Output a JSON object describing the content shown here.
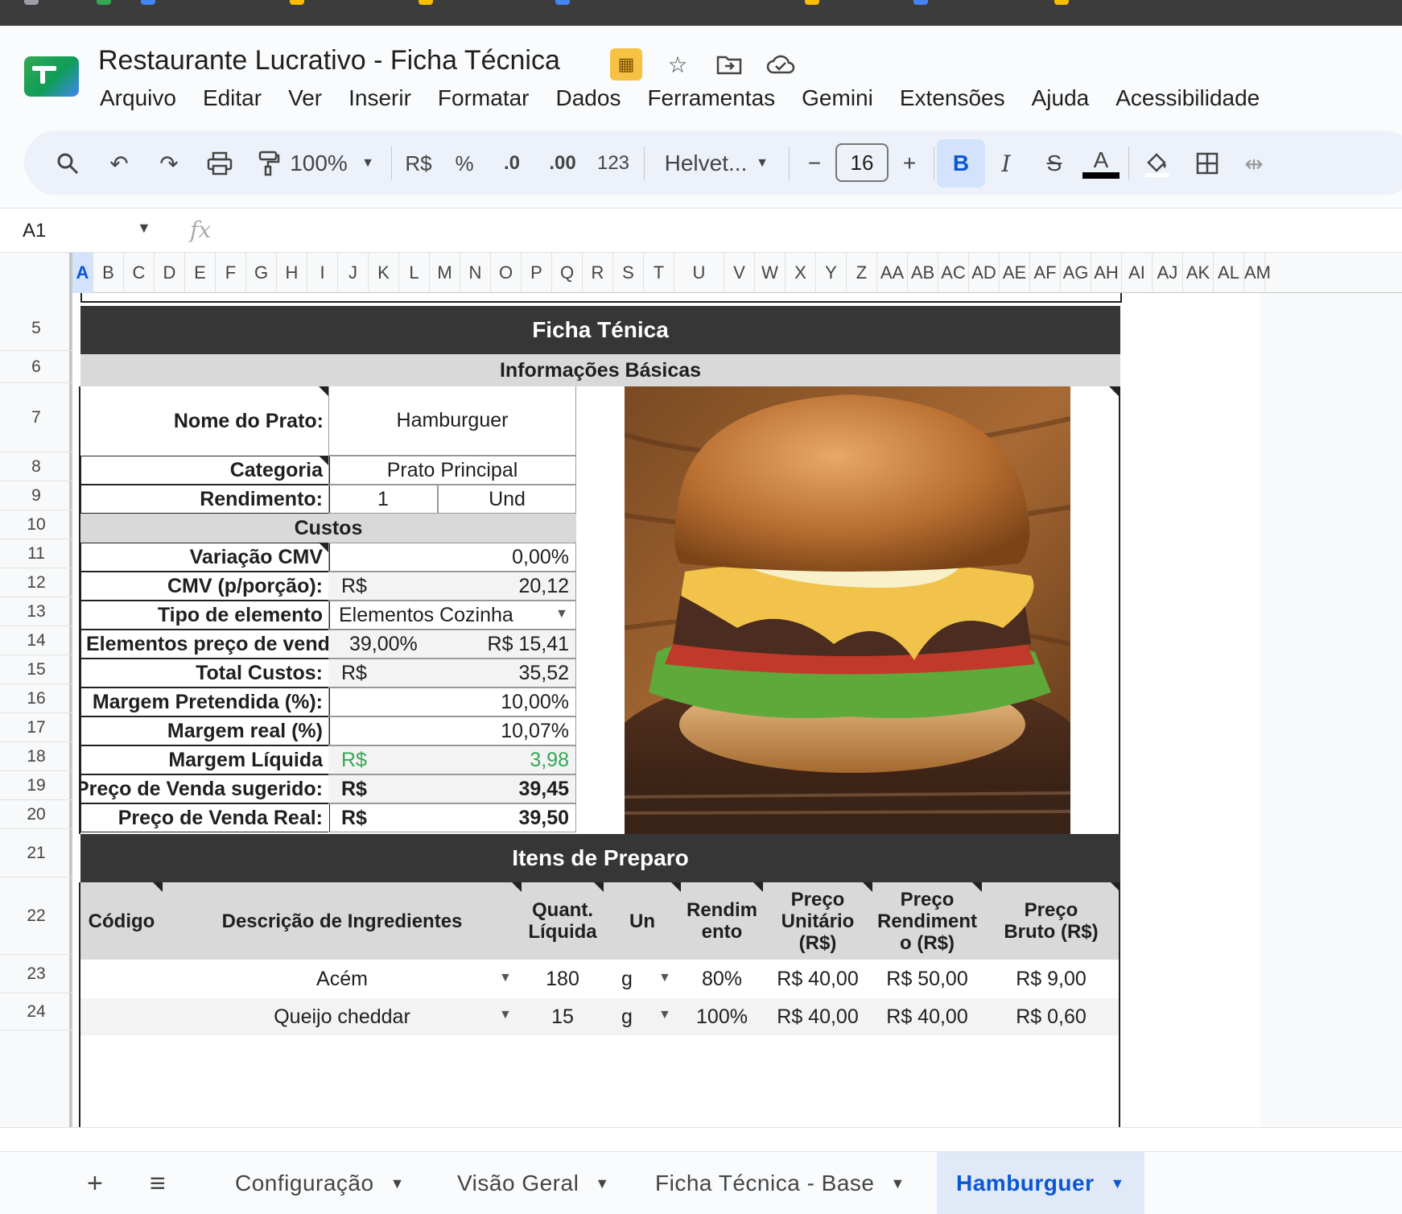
{
  "document": {
    "title": "Restaurante Lucrativo - Ficha Técnica"
  },
  "menu": [
    "Arquivo",
    "Editar",
    "Ver",
    "Inserir",
    "Formatar",
    "Dados",
    "Ferramentas",
    "Gemini",
    "Extensões",
    "Ajuda",
    "Acessibilidade"
  ],
  "toolbar": {
    "zoom": "100%",
    "currency": "R$",
    "percent": "%",
    "decrease_decimals": ".0",
    "increase_decimals": ".00",
    "number_format": "123",
    "font": "Helvet...",
    "font_size": "16",
    "minus": "−",
    "plus": "+",
    "bold": "B",
    "italic": "I",
    "strike": "S",
    "text_color": "A"
  },
  "formula_bar": {
    "cell_ref": "A1",
    "fx": "fx"
  },
  "columns": [
    "A",
    "B",
    "C",
    "D",
    "E",
    "F",
    "G",
    "H",
    "I",
    "J",
    "K",
    "L",
    "M",
    "N",
    "O",
    "P",
    "Q",
    "R",
    "S",
    "T",
    "U",
    "V",
    "W",
    "X",
    "Y",
    "Z",
    "AA",
    "AB",
    "AC",
    "AD",
    "AE",
    "AF",
    "AG",
    "AH",
    "AI",
    "AJ",
    "AK",
    "AL",
    "AM"
  ],
  "rows": [
    "5",
    "6",
    "7",
    "8",
    "9",
    "10",
    "11",
    "12",
    "13",
    "14",
    "15",
    "16",
    "17",
    "18",
    "19",
    "20",
    "21",
    "22",
    "23",
    "24"
  ],
  "sheet": {
    "header_title": "Ficha Ténica",
    "basic_info_title": "Informações Básicas",
    "dish_name_label": "Nome do Prato:",
    "dish_name": "Hamburguer",
    "category_label": "Categoria",
    "category": "Prato Principal",
    "yield_label": "Rendimento:",
    "yield_qty": "1",
    "yield_unit": "Und",
    "costs_title": "Custos",
    "cmv_variation_label": "Variação CMV",
    "cmv_variation": "0,00%",
    "cmv_portion_label": "CMV (p/porção):",
    "cmv_portion_currency": "R$",
    "cmv_portion": "20,12",
    "element_type_label": "Tipo de elemento",
    "element_type": "Elementos Cozinha",
    "sale_elements_label": "Elementos preço de venda (%",
    "sale_elements_pct": "39,00%",
    "sale_elements_value": "R$ 15,41",
    "total_costs_label": "Total Custos:",
    "total_costs_currency": "R$",
    "total_costs": "35,52",
    "target_margin_label": "Margem Pretendida (%):",
    "target_margin": "10,00%",
    "real_margin_label": "Margem real (%)",
    "real_margin": "10,07%",
    "net_margin_label": "Margem Líquida",
    "net_margin_currency": "R$",
    "net_margin": "3,98",
    "suggested_price_label": "Preço de Venda sugerido:",
    "suggested_price_currency": "R$",
    "suggested_price": "39,45",
    "real_price_label": "Preço de Venda Real:",
    "real_price_currency": "R$",
    "real_price": "39,50",
    "prep_title": "Itens de Preparo",
    "table_headers": {
      "code": "Código",
      "description": "Descrição de Ingredientes",
      "net_qty": "Quant. Líquida",
      "unit": "Un",
      "yield": "Rendim ento",
      "unit_price": "Preço Unitário (R$)",
      "yield_price": "Preço Rendiment o (R$)",
      "gross_price": "Preço Bruto (R$)"
    },
    "ingredients": [
      {
        "code": "",
        "description": "Acém",
        "qty": "180",
        "unit": "g",
        "yield": "80%",
        "unit_price": "R$ 40,00",
        "yield_price": "R$ 50,00",
        "gross_price": "R$ 9,00"
      },
      {
        "code": "",
        "description": "Queijo cheddar",
        "qty": "15",
        "unit": "g",
        "yield": "100%",
        "unit_price": "R$ 40,00",
        "yield_price": "R$ 40,00",
        "gross_price": "R$ 0,60"
      }
    ]
  },
  "tabs": {
    "add": "+",
    "all_sheets": "≡",
    "items": [
      "Configuração",
      "Visão Geral",
      "Ficha Técnica - Base",
      "Hamburguer"
    ]
  },
  "colors": {
    "accent": "#0b57d0",
    "band_dark": "#363636",
    "band_gray": "#d9d9d9",
    "positive": "#34a853"
  }
}
